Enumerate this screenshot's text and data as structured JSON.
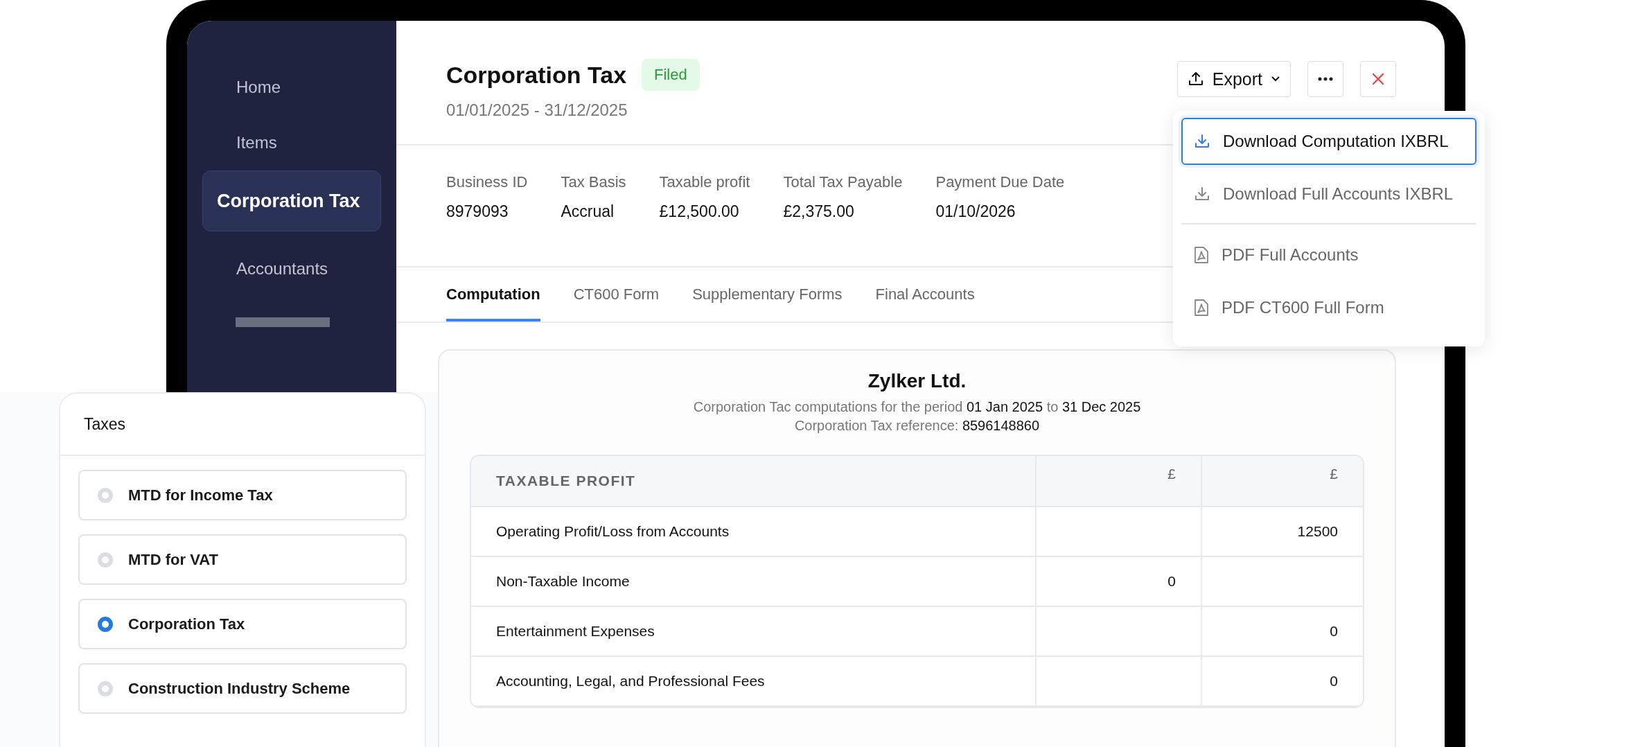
{
  "sidebar": {
    "items": [
      {
        "label": "Home",
        "selected": false
      },
      {
        "label": "Items",
        "selected": false
      },
      {
        "label": "Corporation Tax",
        "selected": true
      },
      {
        "label": "Accountants",
        "selected": false
      }
    ]
  },
  "header": {
    "title": "Corporation Tax",
    "status": "Filed",
    "period": "01/01/2025 - 31/12/2025",
    "export_label": "Export"
  },
  "summary": [
    {
      "label": "Business ID",
      "value": "8979093"
    },
    {
      "label": "Tax Basis",
      "value": "Accrual"
    },
    {
      "label": "Taxable profit",
      "value": "£12,500.00"
    },
    {
      "label": "Total Tax Payable",
      "value": "£2,375.00"
    },
    {
      "label": "Payment Due Date",
      "value": "01/10/2026"
    }
  ],
  "tabs": [
    {
      "label": "Computation",
      "selected": true
    },
    {
      "label": "CT600 Form",
      "selected": false
    },
    {
      "label": "Supplementary Forms",
      "selected": false
    },
    {
      "label": "Final Accounts",
      "selected": false
    }
  ],
  "export_menu": {
    "groups": [
      [
        {
          "label": "Download Computation IXBRL",
          "kind": "download",
          "selected": true
        },
        {
          "label": "Download Full Accounts IXBRL",
          "kind": "download",
          "selected": false
        }
      ],
      [
        {
          "label": "PDF Full Accounts",
          "kind": "pdf",
          "selected": false
        },
        {
          "label": "PDF CT600 Full Form",
          "kind": "pdf",
          "selected": false
        }
      ]
    ]
  },
  "computation": {
    "company": "Zylker Ltd.",
    "period_line": "Corporation Tac computations for the period **01 Jan 2025** to **31 Dec 2025**",
    "reference_line": "Corporation Tax reference: **8596148860**",
    "table": {
      "columns": [
        "TAXABLE PROFIT",
        "£",
        "£"
      ],
      "rows": [
        {
          "label": "Operating Profit/Loss from Accounts",
          "column_3": "12500"
        },
        {
          "label": "Non-Taxable Income",
          "column_2": "0"
        },
        {
          "label": "Entertainment Expenses",
          "column_3": "0"
        },
        {
          "label": "Accounting, Legal, and Professional Fees",
          "column_3": "0"
        }
      ]
    }
  },
  "taxes_panel": {
    "title": "Taxes",
    "options": [
      {
        "label": "MTD for Income Tax",
        "selected": false
      },
      {
        "label": "MTD for VAT",
        "selected": false
      },
      {
        "label": "Corporation Tax",
        "selected": true
      },
      {
        "label": "Construction Industry Scheme",
        "selected": false
      }
    ]
  }
}
